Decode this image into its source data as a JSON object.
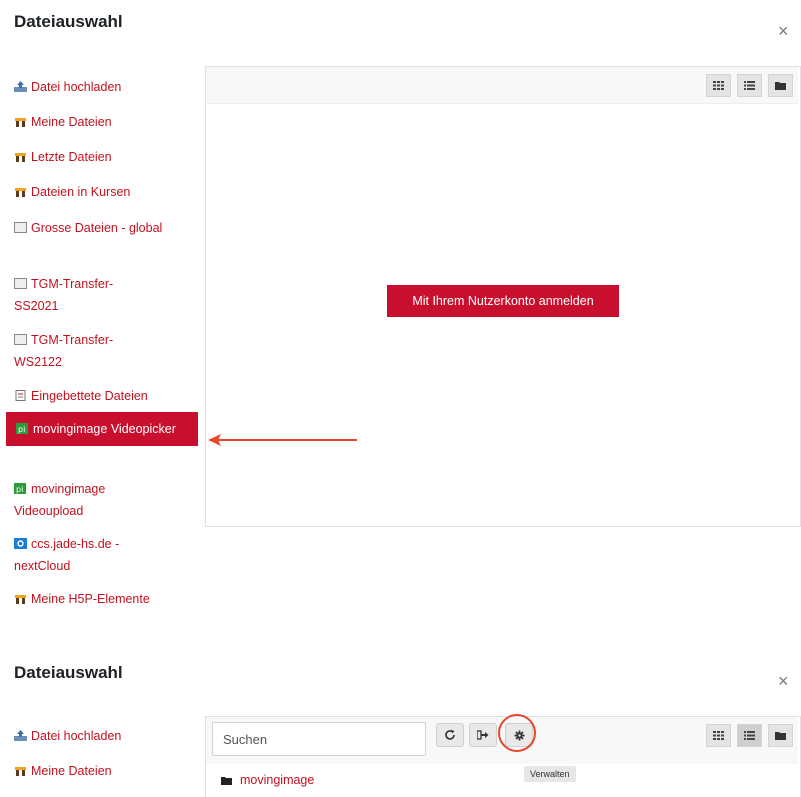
{
  "dialog1": {
    "title": "Dateiauswahl",
    "close": "×",
    "sidebar": [
      {
        "label": "Datei hochladen",
        "icon": "upload-icon"
      },
      {
        "label": "Meine Dateien",
        "icon": "user-files-icon"
      },
      {
        "label": "Letzte Dateien",
        "icon": "user-files-icon"
      },
      {
        "label": "Dateien in Kursen",
        "icon": "user-files-icon"
      },
      {
        "label": "Grosse Dateien - global",
        "icon": "repository-icon"
      },
      {
        "label": "TGM-Transfer-SS2021",
        "icon": "repository-icon"
      },
      {
        "label": "TGM-Transfer-WS2122",
        "icon": "repository-icon"
      },
      {
        "label": "Eingebettete Dateien",
        "icon": "embedded-files-icon"
      },
      {
        "label": "movingimage Videopicker",
        "icon": "movingimage-icon",
        "active": true
      },
      {
        "label": "movingimage Videoupload",
        "icon": "movingimage-icon"
      },
      {
        "label": "ccs.jade-hs.de - nextCloud",
        "icon": "nextcloud-icon"
      },
      {
        "label": "Meine H5P-Elemente",
        "icon": "user-files-icon"
      }
    ],
    "login_button": "Mit Ihrem Nutzerkonto anmelden"
  },
  "dialog2": {
    "title": "Dateiauswahl",
    "close": "×",
    "sidebar": [
      {
        "label": "Datei hochladen",
        "icon": "upload-icon"
      },
      {
        "label": "Meine Dateien",
        "icon": "user-files-icon"
      }
    ],
    "search_placeholder": "Suchen",
    "tooltip": "Verwalten",
    "folder_item": "movingimage"
  },
  "colors": {
    "accent": "#c8102e",
    "link": "#c1121f",
    "annotation": "#e8472b"
  }
}
